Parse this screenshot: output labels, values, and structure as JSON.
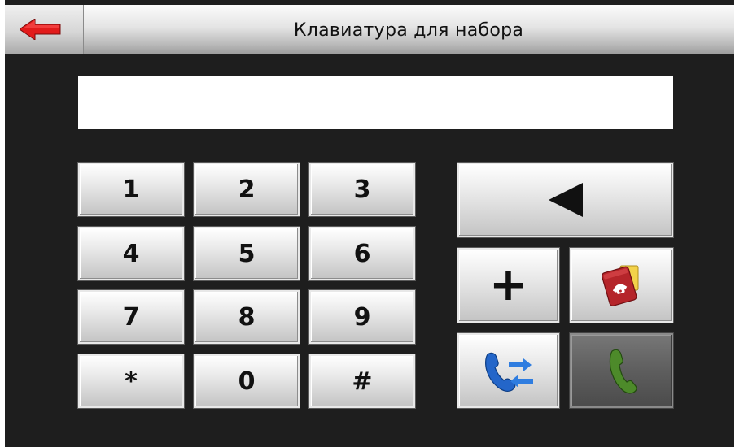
{
  "header": {
    "title": "Клавиатура для набора",
    "back_icon": "back-arrow-icon",
    "back_icon_color": "#e21b1b"
  },
  "display": {
    "value": ""
  },
  "keypad": {
    "k1": "1",
    "k2": "2",
    "k3": "3",
    "k4": "4",
    "k5": "5",
    "k6": "6",
    "k7": "7",
    "k8": "8",
    "k9": "9",
    "kstar": "*",
    "k0": "0",
    "khash": "#"
  },
  "actions": {
    "backspace_icon": "backspace-triangle-icon",
    "plus_label": "+",
    "phonebook_icon": "phonebook-icon",
    "transfer_icon": "call-transfer-icon",
    "call_icon": "call-handset-icon",
    "call_color": "#4d8a2a",
    "transfer_color": "#2466c9",
    "phonebook_color": "#b5252a"
  }
}
